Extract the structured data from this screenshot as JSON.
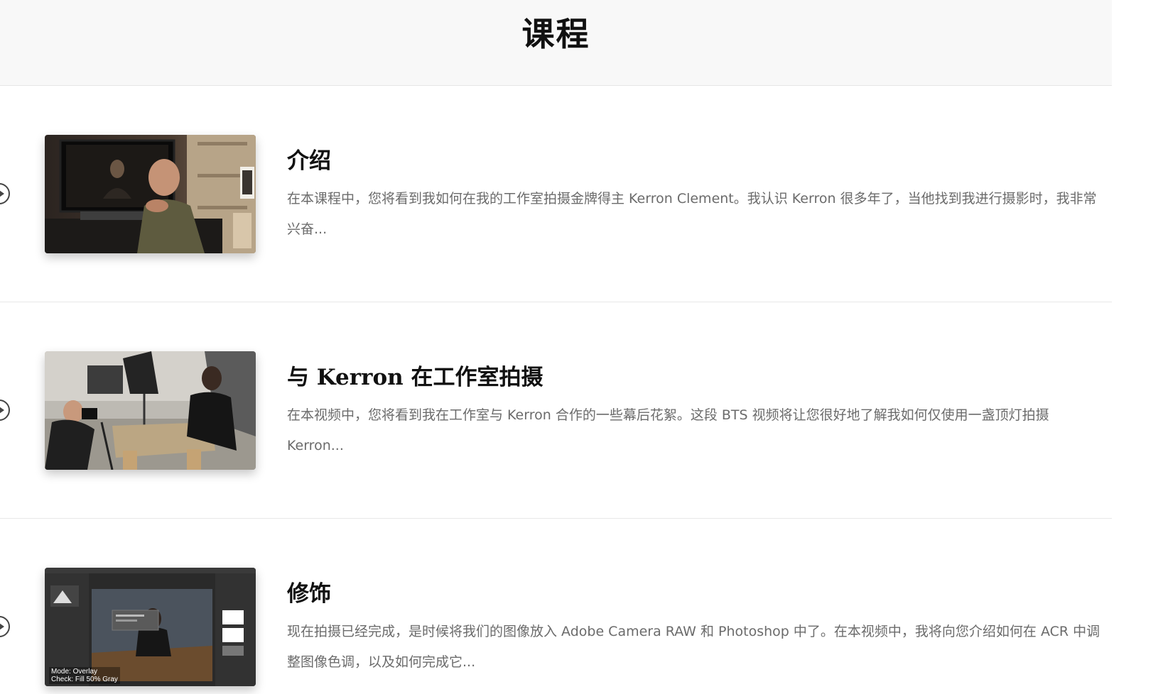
{
  "header": {
    "title": "课程"
  },
  "lessons": [
    {
      "title": "介绍",
      "description": "在本课程中，您将看到我如何在我的工作室拍摄金牌得主 Kerron Clement。我认识 Kerron 很多年了，当他找到我进行摄影时，我非常兴奋...",
      "thumbnail_icon": "video-thumbnail-interview"
    },
    {
      "title": "与 Kerron 在工作室拍摄",
      "description": "在本视频中，您将看到我在工作室与 Kerron 合作的一些幕后花絮。这段 BTS 视频将让您很好地了解我如何仅使用一盏顶灯拍摄 Kerron...",
      "thumbnail_icon": "video-thumbnail-studio"
    },
    {
      "title": "修饰",
      "description": "现在拍摄已经完成，是时候将我们的图像放入 Adobe Camera RAW 和 Photoshop 中了。在本视频中，我将向您介绍如何在 ACR 中调整图像色调，以及如何完成它...",
      "thumbnail_icon": "video-thumbnail-photoshop",
      "thumbnail_overlay": {
        "line1": "Mode: Overlay",
        "line2": "Check: Fill 50% Gray"
      }
    }
  ],
  "icons": {
    "play": "play-circle-icon"
  },
  "colors": {
    "header_bg": "#f8f8f8",
    "title": "#111111",
    "description": "#6b6b6b",
    "divider": "#e8e8e8"
  }
}
